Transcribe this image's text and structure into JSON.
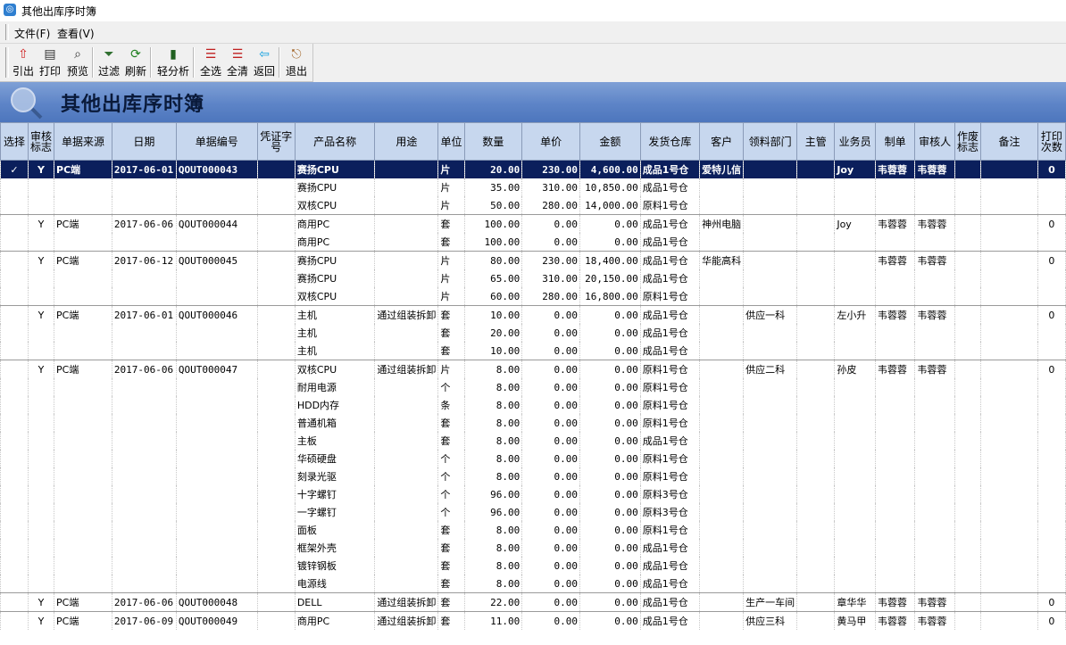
{
  "window": {
    "title": "其他出库序时簿"
  },
  "menu": [
    {
      "label": "文件(F)"
    },
    {
      "label": "查看(V)"
    }
  ],
  "toolbar": [
    {
      "label": "引出",
      "icon": "export-icon",
      "glyph": "⇧",
      "color": "#d02020"
    },
    {
      "label": "打印",
      "icon": "print-icon",
      "glyph": "▤",
      "color": "#303030"
    },
    {
      "label": "预览",
      "icon": "preview-icon",
      "glyph": "⌕",
      "color": "#303030"
    },
    {
      "label": "过滤",
      "icon": "filter-icon",
      "glyph": "⏷",
      "color": "#307030"
    },
    {
      "label": "刷新",
      "icon": "refresh-icon",
      "glyph": "⟳",
      "color": "#208020"
    },
    {
      "label": "轻分析",
      "icon": "analysis-icon",
      "glyph": "▮",
      "color": "#206020"
    },
    {
      "label": "全选",
      "icon": "select-all-icon",
      "glyph": "☰",
      "color": "#c02020"
    },
    {
      "label": "全清",
      "icon": "clear-all-icon",
      "glyph": "☰",
      "color": "#c02020"
    },
    {
      "label": "返回",
      "icon": "back-icon",
      "glyph": "⇦",
      "color": "#10a0e0"
    },
    {
      "label": "退出",
      "icon": "exit-icon",
      "glyph": "⎋",
      "color": "#a06020"
    }
  ],
  "banner": {
    "title": "其他出库序时簿"
  },
  "columns": [
    "选择",
    "审核标志",
    "单据来源",
    "日期",
    "单据编号",
    "凭证字号",
    "产品名称",
    "用途",
    "单位",
    "数量",
    "单价",
    "金额",
    "发货仓库",
    "客户",
    "领料部门",
    "主管",
    "业务员",
    "制单",
    "审核人",
    "作废标志",
    "备注",
    "打印次数"
  ],
  "rows": [
    {
      "s": "✓",
      "a": "Y",
      "src": "PC端",
      "date": "2017-06-01",
      "no": "QOUT000043",
      "v": "",
      "p": "赛扬CPU",
      "use": "",
      "u": "片",
      "q": "20.00",
      "pr": "230.00",
      "amt": "4,600.00",
      "wh": "成品1号仓",
      "cust": "爱特儿信",
      "dept": "",
      "mgr": "",
      "sales": "Joy",
      "maker": "韦蓉蓉",
      "aud": "韦蓉蓉",
      "void": "",
      "note": "",
      "pc": "0",
      "sel": true,
      "gs": true
    },
    {
      "p": "赛扬CPU",
      "u": "片",
      "q": "35.00",
      "pr": "310.00",
      "amt": "10,850.00",
      "wh": "成品1号仓"
    },
    {
      "p": "双核CPU",
      "u": "片",
      "q": "50.00",
      "pr": "280.00",
      "amt": "14,000.00",
      "wh": "原料1号仓"
    },
    {
      "a": "Y",
      "src": "PC端",
      "date": "2017-06-06",
      "no": "QOUT000044",
      "p": "商用PC",
      "u": "套",
      "q": "100.00",
      "pr": "0.00",
      "amt": "0.00",
      "wh": "成品1号仓",
      "cust": "神州电脑",
      "sales": "Joy",
      "maker": "韦蓉蓉",
      "aud": "韦蓉蓉",
      "pc": "0",
      "gs": true
    },
    {
      "p": "商用PC",
      "u": "套",
      "q": "100.00",
      "pr": "0.00",
      "amt": "0.00",
      "wh": "成品1号仓"
    },
    {
      "a": "Y",
      "src": "PC端",
      "date": "2017-06-12",
      "no": "QOUT000045",
      "p": "赛扬CPU",
      "u": "片",
      "q": "80.00",
      "pr": "230.00",
      "amt": "18,400.00",
      "wh": "成品1号仓",
      "cust": "华能高科",
      "maker": "韦蓉蓉",
      "aud": "韦蓉蓉",
      "pc": "0",
      "gs": true
    },
    {
      "p": "赛扬CPU",
      "u": "片",
      "q": "65.00",
      "pr": "310.00",
      "amt": "20,150.00",
      "wh": "成品1号仓"
    },
    {
      "p": "双核CPU",
      "u": "片",
      "q": "60.00",
      "pr": "280.00",
      "amt": "16,800.00",
      "wh": "原料1号仓"
    },
    {
      "a": "Y",
      "src": "PC端",
      "date": "2017-06-01",
      "no": "QOUT000046",
      "p": "主机",
      "use": "通过组装拆卸",
      "u": "套",
      "q": "10.00",
      "pr": "0.00",
      "amt": "0.00",
      "wh": "成品1号仓",
      "dept": "供应一科",
      "sales": "左小升",
      "maker": "韦蓉蓉",
      "aud": "韦蓉蓉",
      "pc": "0",
      "gs": true
    },
    {
      "p": "主机",
      "u": "套",
      "q": "20.00",
      "pr": "0.00",
      "amt": "0.00",
      "wh": "成品1号仓"
    },
    {
      "p": "主机",
      "u": "套",
      "q": "10.00",
      "pr": "0.00",
      "amt": "0.00",
      "wh": "成品1号仓"
    },
    {
      "a": "Y",
      "src": "PC端",
      "date": "2017-06-06",
      "no": "QOUT000047",
      "p": "双核CPU",
      "use": "通过组装拆卸",
      "u": "片",
      "q": "8.00",
      "pr": "0.00",
      "amt": "0.00",
      "wh": "原料1号仓",
      "dept": "供应二科",
      "sales": "孙皮",
      "maker": "韦蓉蓉",
      "aud": "韦蓉蓉",
      "pc": "0",
      "gs": true
    },
    {
      "p": "耐用电源",
      "u": "个",
      "q": "8.00",
      "pr": "0.00",
      "amt": "0.00",
      "wh": "原料1号仓"
    },
    {
      "p": "HDD内存",
      "u": "条",
      "q": "8.00",
      "pr": "0.00",
      "amt": "0.00",
      "wh": "原料1号仓"
    },
    {
      "p": "普通机箱",
      "u": "套",
      "q": "8.00",
      "pr": "0.00",
      "amt": "0.00",
      "wh": "原料1号仓"
    },
    {
      "p": "主板",
      "u": "套",
      "q": "8.00",
      "pr": "0.00",
      "amt": "0.00",
      "wh": "成品1号仓"
    },
    {
      "p": "华硕硬盘",
      "u": "个",
      "q": "8.00",
      "pr": "0.00",
      "amt": "0.00",
      "wh": "原料1号仓"
    },
    {
      "p": "刻录光驱",
      "u": "个",
      "q": "8.00",
      "pr": "0.00",
      "amt": "0.00",
      "wh": "原料1号仓"
    },
    {
      "p": "十字螺钉",
      "u": "个",
      "q": "96.00",
      "pr": "0.00",
      "amt": "0.00",
      "wh": "原料3号仓"
    },
    {
      "p": "一字螺钉",
      "u": "个",
      "q": "96.00",
      "pr": "0.00",
      "amt": "0.00",
      "wh": "原料3号仓"
    },
    {
      "p": "面板",
      "u": "套",
      "q": "8.00",
      "pr": "0.00",
      "amt": "0.00",
      "wh": "原料1号仓"
    },
    {
      "p": "框架外壳",
      "u": "套",
      "q": "8.00",
      "pr": "0.00",
      "amt": "0.00",
      "wh": "成品1号仓"
    },
    {
      "p": "镀锌钢板",
      "u": "套",
      "q": "8.00",
      "pr": "0.00",
      "amt": "0.00",
      "wh": "成品1号仓"
    },
    {
      "p": "电源线",
      "u": "套",
      "q": "8.00",
      "pr": "0.00",
      "amt": "0.00",
      "wh": "成品1号仓"
    },
    {
      "a": "Y",
      "src": "PC端",
      "date": "2017-06-06",
      "no": "QOUT000048",
      "p": "DELL",
      "use": "通过组装拆卸",
      "u": "套",
      "q": "22.00",
      "pr": "0.00",
      "amt": "0.00",
      "wh": "成品1号仓",
      "dept": "生产一车间",
      "sales": "章华华",
      "maker": "韦蓉蓉",
      "aud": "韦蓉蓉",
      "pc": "0",
      "gs": true
    },
    {
      "a": "Y",
      "src": "PC端",
      "date": "2017-06-09",
      "no": "QOUT000049",
      "p": "商用PC",
      "use": "通过组装拆卸",
      "u": "套",
      "q": "11.00",
      "pr": "0.00",
      "amt": "0.00",
      "wh": "成品1号仓",
      "dept": "供应三科",
      "sales": "黄马甲",
      "maker": "韦蓉蓉",
      "aud": "韦蓉蓉",
      "pc": "0",
      "gs": true
    }
  ]
}
